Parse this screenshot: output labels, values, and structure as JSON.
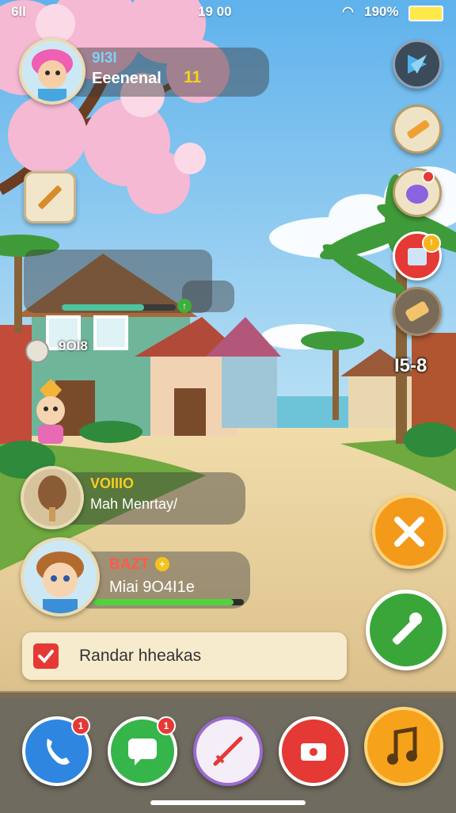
{
  "status_bar": {
    "signal": "6ll",
    "time": "19 00",
    "battery": "190%"
  },
  "player": {
    "id": "9I3I",
    "name": "Eeenenal",
    "level": "11"
  },
  "building": {
    "progress": 0.72,
    "count_label": "9OI8"
  },
  "side_counter": "I5-8",
  "event": {
    "title": "VOIIIO",
    "subtitle": "Mah Menrtay/"
  },
  "friend": {
    "name": "BAZT",
    "status": "Miai 9O4I1e",
    "progress": 0.93
  },
  "notice": {
    "text": "Randar hheakas"
  },
  "dock": {
    "phone_badge": "1",
    "chat_badge": "1"
  },
  "colors": {
    "sky": "#7cc3ec",
    "sand": "#e8cf9c",
    "accent_green": "#4caf50",
    "accent_orange": "#f7a21b"
  }
}
